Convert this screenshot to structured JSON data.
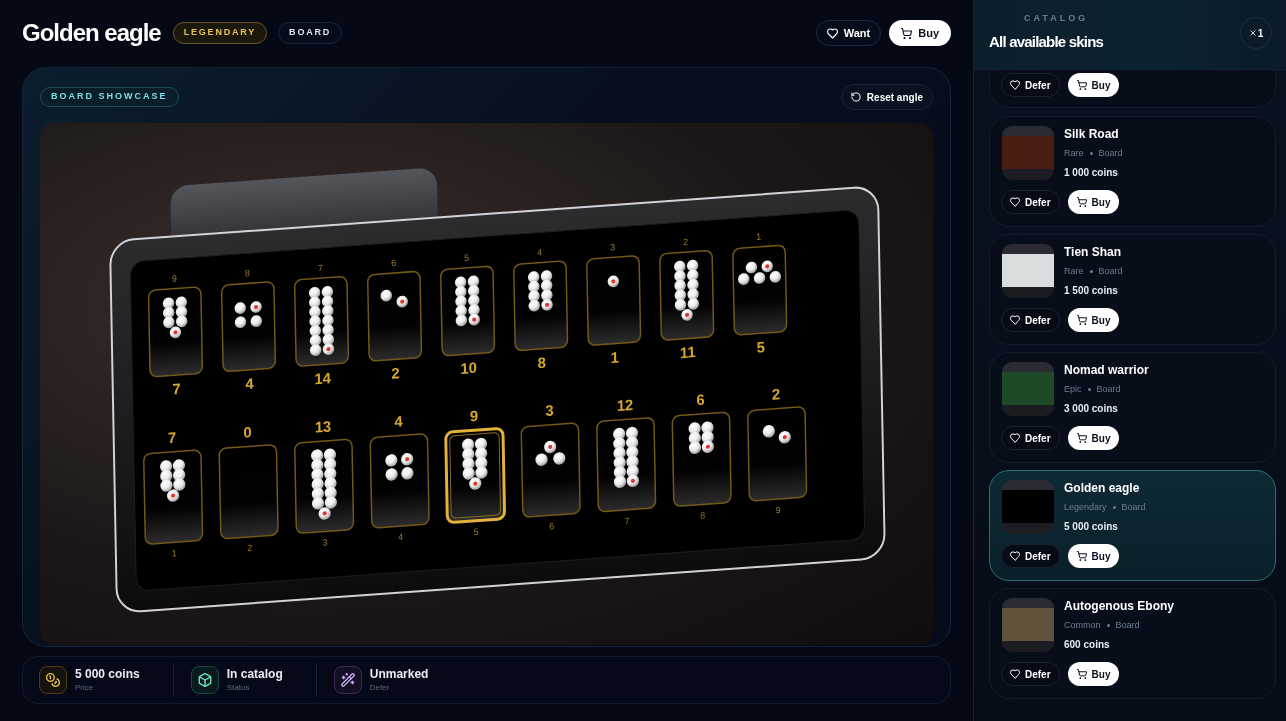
{
  "header": {
    "title": "Golden eagle",
    "badges": [
      {
        "label": "LEGENDARY",
        "kind": "rarity"
      },
      {
        "label": "BOARD",
        "kind": "type"
      }
    ],
    "want_button": "Want",
    "buy_button": "Buy"
  },
  "showcase": {
    "badge": "BOARD SHOWCASE",
    "reset_button": "Reset angle",
    "board": {
      "top_row": [
        {
          "pit_number": "9",
          "count": "7",
          "selected": false
        },
        {
          "pit_number": "8",
          "count": "4",
          "selected": false
        },
        {
          "pit_number": "7",
          "count": "14",
          "selected": false
        },
        {
          "pit_number": "6",
          "count": "2",
          "selected": false
        },
        {
          "pit_number": "5",
          "count": "10",
          "selected": false
        },
        {
          "pit_number": "4",
          "count": "8",
          "selected": false
        },
        {
          "pit_number": "3",
          "count": "1",
          "selected": false
        },
        {
          "pit_number": "2",
          "count": "11",
          "selected": false
        },
        {
          "pit_number": "1",
          "count": "5",
          "selected": false
        }
      ],
      "bottom_row": [
        {
          "pit_number": "1",
          "count": "7",
          "selected": false
        },
        {
          "pit_number": "2",
          "count": "0",
          "selected": false
        },
        {
          "pit_number": "3",
          "count": "13",
          "selected": false
        },
        {
          "pit_number": "4",
          "count": "4",
          "selected": false
        },
        {
          "pit_number": "5",
          "count": "9",
          "selected": true
        },
        {
          "pit_number": "6",
          "count": "3",
          "selected": false
        },
        {
          "pit_number": "7",
          "count": "12",
          "selected": false
        },
        {
          "pit_number": "8",
          "count": "6",
          "selected": false
        },
        {
          "pit_number": "9",
          "count": "2",
          "selected": false
        }
      ]
    }
  },
  "stats": [
    {
      "kind": "price",
      "value": "5 000 coins",
      "label": "Price"
    },
    {
      "kind": "status",
      "value": "In catalog",
      "label": "Status"
    },
    {
      "kind": "defer",
      "value": "Unmarked",
      "label": "Defer"
    }
  ],
  "catalog": {
    "eyebrow": "CATALOG",
    "title": "All available skins",
    "close_button": "1",
    "items": [
      {
        "defer_button": "Defer",
        "buy_button": "Buy",
        "selected": false
      },
      {
        "name": "Silk Road",
        "rarity": "Rare",
        "type": "Board",
        "price": "1 000 coins",
        "color": "#4a1d14",
        "defer_button": "Defer",
        "buy_button": "Buy",
        "selected": false
      },
      {
        "name": "Tien Shan",
        "rarity": "Rare",
        "type": "Board",
        "price": "1 500 coins",
        "color": "#d9dddd",
        "defer_button": "Defer",
        "buy_button": "Buy",
        "selected": false
      },
      {
        "name": "Nomad warrior",
        "rarity": "Epic",
        "type": "Board",
        "price": "3 000 coins",
        "color": "#1f4a27",
        "defer_button": "Defer",
        "buy_button": "Buy",
        "selected": false
      },
      {
        "name": "Golden eagle",
        "rarity": "Legendary",
        "type": "Board",
        "price": "5 000 coins",
        "color": "#000000",
        "defer_button": "Defer",
        "buy_button": "Buy",
        "selected": true
      },
      {
        "name": "Autogenous Ebony",
        "rarity": "Common",
        "type": "Board",
        "price": "600 coins",
        "color": "#5f533c",
        "defer_button": "Defer",
        "buy_button": "Buy",
        "selected": false
      }
    ]
  }
}
